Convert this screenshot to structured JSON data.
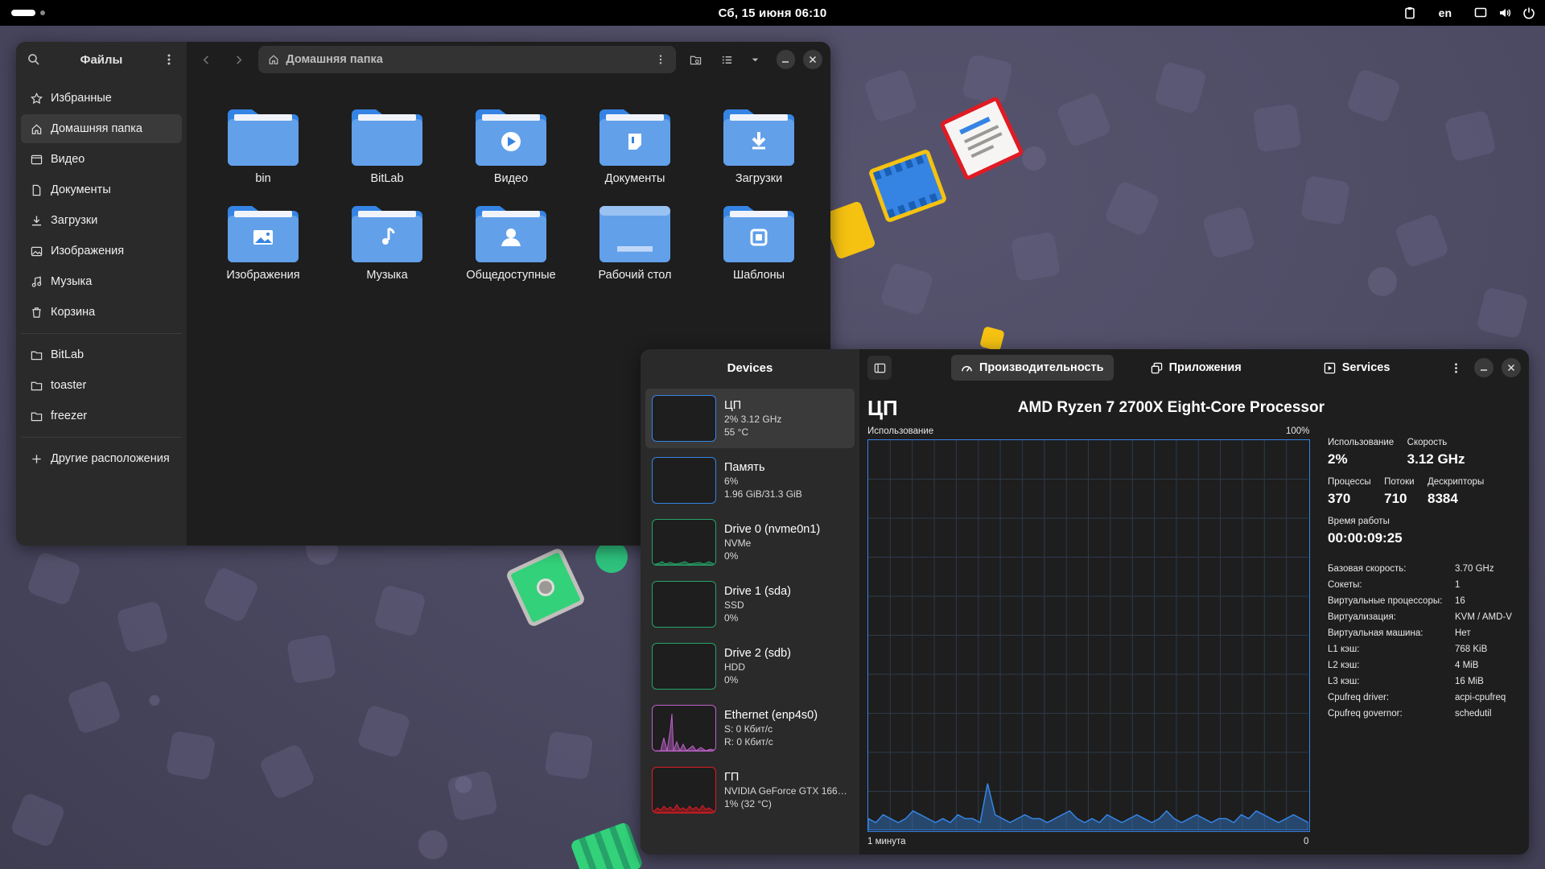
{
  "topbar": {
    "datetime": "Сб, 15 июня  06:10",
    "lang": "en"
  },
  "files": {
    "title": "Файлы",
    "path": "Домашняя папка",
    "places": [
      {
        "label": "Избранные",
        "icon": "star-icon"
      },
      {
        "label": "Домашняя папка",
        "icon": "home-icon"
      },
      {
        "label": "Видео",
        "icon": "video-icon"
      },
      {
        "label": "Документы",
        "icon": "document-icon"
      },
      {
        "label": "Загрузки",
        "icon": "download-icon"
      },
      {
        "label": "Изображения",
        "icon": "image-icon"
      },
      {
        "label": "Музыка",
        "icon": "music-icon"
      },
      {
        "label": "Корзина",
        "icon": "trash-icon"
      }
    ],
    "bookmarks": [
      {
        "label": "BitLab",
        "icon": "folder-icon"
      },
      {
        "label": "toaster",
        "icon": "folder-icon"
      },
      {
        "label": "freezer",
        "icon": "folder-icon"
      }
    ],
    "other_locations": "Другие расположения",
    "items": [
      {
        "label": "bin",
        "emblem": "none"
      },
      {
        "label": "BitLab",
        "emblem": "none"
      },
      {
        "label": "Видео",
        "emblem": "play"
      },
      {
        "label": "Документы",
        "emblem": "document"
      },
      {
        "label": "Загрузки",
        "emblem": "download"
      },
      {
        "label": "Изображения",
        "emblem": "image"
      },
      {
        "label": "Музыка",
        "emblem": "music"
      },
      {
        "label": "Общедоступные",
        "emblem": "person"
      },
      {
        "label": "Рабочий стол",
        "emblem": "desktop"
      },
      {
        "label": "Шаблоны",
        "emblem": "template"
      }
    ]
  },
  "monitor": {
    "devices_title": "Devices",
    "devices": [
      {
        "name": "ЦП",
        "line1": "2% 3.12 GHz",
        "line2": "55 °C",
        "color": "#3584e4",
        "kind": "cpu"
      },
      {
        "name": "Память",
        "line1": "6%",
        "line2": "1.96 GiB/31.3 GiB",
        "color": "#3584e4",
        "kind": "mem"
      },
      {
        "name": "Drive 0 (nvme0n1)",
        "line1": "NVMe",
        "line2": "0%",
        "color": "#26a269",
        "kind": "drive0"
      },
      {
        "name": "Drive 1 (sda)",
        "line1": "SSD",
        "line2": "0%",
        "color": "#26a269",
        "kind": "drive1"
      },
      {
        "name": "Drive 2 (sdb)",
        "line1": "HDD",
        "line2": "0%",
        "color": "#26a269",
        "kind": "drive2"
      },
      {
        "name": "Ethernet (enp4s0)",
        "line1": "S: 0 Кбит/с",
        "line2": "R: 0 Кбит/с",
        "color": "#c061cb",
        "kind": "net"
      },
      {
        "name": "ГП",
        "line1": "NVIDIA GeForce GTX 166…",
        "line2": "1% (32 °C)",
        "color": "#e01b24",
        "kind": "gpu"
      }
    ],
    "tabs": [
      {
        "label": "Производительность",
        "icon": "gauge-icon"
      },
      {
        "label": "Приложения",
        "icon": "apps-icon"
      },
      {
        "label": "Services",
        "icon": "services-icon"
      }
    ],
    "cpu_title": "ЦП",
    "cpu_model": "AMD Ryzen 7 2700X Eight-Core Processor",
    "usage_label": "Использование",
    "usage_max": "100%",
    "time_label": "1 минута",
    "time_end": "0",
    "stats": {
      "usage_label": "Использование",
      "usage_value": "2%",
      "speed_label": "Скорость",
      "speed_value": "3.12 GHz",
      "proc_label": "Процессы",
      "proc_value": "370",
      "threads_label": "Потоки",
      "threads_value": "710",
      "handles_label": "Дескрипторы",
      "handles_value": "8384",
      "uptime_label": "Время работы",
      "uptime_value": "00:00:09:25"
    },
    "details": [
      {
        "k": "Базовая скорость:",
        "v": "3.70 GHz"
      },
      {
        "k": "Сокеты:",
        "v": "1"
      },
      {
        "k": "Виртуальные процессоры:",
        "v": "16"
      },
      {
        "k": "Виртуализация:",
        "v": "KVM / AMD-V"
      },
      {
        "k": "Виртуальная машина:",
        "v": "Нет"
      },
      {
        "k": "L1 кэш:",
        "v": "768 KiB"
      },
      {
        "k": "L2 кэш:",
        "v": "4 MiB"
      },
      {
        "k": "L3 кэш:",
        "v": "16 MiB"
      },
      {
        "k": "Cpufreq driver:",
        "v": "acpi-cpufreq"
      },
      {
        "k": "Cpufreq governor:",
        "v": "schedutil"
      }
    ],
    "cpu_history": [
      3,
      2,
      4,
      3,
      2,
      3,
      5,
      4,
      3,
      2,
      3,
      2,
      4,
      3,
      3,
      2,
      12,
      4,
      3,
      2,
      3,
      4,
      3,
      3,
      2,
      3,
      4,
      5,
      3,
      2,
      3,
      2,
      4,
      3,
      2,
      3,
      4,
      3,
      2,
      3,
      5,
      3,
      2,
      3,
      4,
      3,
      2,
      3,
      3,
      2,
      4,
      3,
      5,
      4,
      3,
      2,
      3,
      4,
      3,
      2
    ]
  }
}
